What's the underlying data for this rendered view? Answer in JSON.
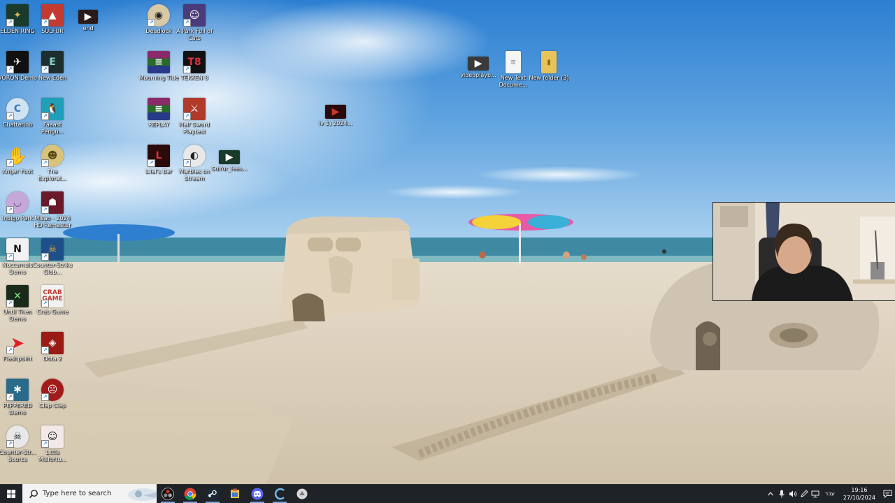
{
  "desktop": {
    "icons": [
      {
        "label": "ELDEN RING",
        "icon": "elden-ring-icon",
        "color": "#1a3a2c"
      },
      {
        "label": "SULFUR",
        "icon": "sulfur-icon",
        "color": "#c23a30"
      },
      {
        "label": "end",
        "icon": "video-file-icon",
        "color": "#2a1a1a"
      },
      {
        "label": "Deadlock",
        "icon": "deadlock-icon",
        "color": "#d7c9a4"
      },
      {
        "label": "A Park Full of Cats",
        "icon": "park-full-of-cats-icon",
        "color": "#4a3b7a"
      },
      {
        "label": "VORON Demo",
        "icon": "voron-icon",
        "color": "#111111"
      },
      {
        "label": "New Eden",
        "icon": "new-eden-icon",
        "color": "#1f2e2e"
      },
      {
        "label": "Mourning Tide",
        "icon": "winrar-icon",
        "color": "#8a2a6a"
      },
      {
        "label": "TEKKEN 8",
        "icon": "tekken-icon",
        "color": "#111111"
      },
      {
        "label": "Chatterino",
        "icon": "chatterino-icon",
        "color": "#cfe3f2"
      },
      {
        "label": "Faaast Pengu...",
        "icon": "penguin-icon",
        "color": "#1f9fb8"
      },
      {
        "label": "REPLAY",
        "icon": "winrar-icon",
        "color": "#8a2a6a"
      },
      {
        "label": "Half Sword Playtest",
        "icon": "half-sword-icon",
        "color": "#b23a2a"
      },
      {
        "label": "Anger Foot",
        "icon": "anger-foot-icon",
        "color": "#e0307a"
      },
      {
        "label": "The Explorat...",
        "icon": "explorer-icon",
        "color": "#d8c37a"
      },
      {
        "label": "Lilal's Bar",
        "icon": "lilals-bar-icon",
        "color": "#2a0a0a"
      },
      {
        "label": "Marbles on Stream",
        "icon": "marbles-icon",
        "color": "#e8e8e8"
      },
      {
        "label": "Sulfur_leas...",
        "icon": "video-file-icon",
        "color": "#1a3a2a"
      },
      {
        "label": "Indigo Park",
        "icon": "indigo-park-icon",
        "color": "#c5a8d8"
      },
      {
        "label": "Misao - 2024 HD Remaster",
        "icon": "misao-icon",
        "color": "#6a1a2a"
      },
      {
        "label": "Nocturnals Demo",
        "icon": "nocturnals-icon",
        "color": "#f2f2f2"
      },
      {
        "label": "Counter-Strike Glob...",
        "icon": "csgo-icon",
        "color": "#1d4f8a"
      },
      {
        "label": "Until Then Demo",
        "icon": "until-then-icon",
        "color": "#1a2a1a"
      },
      {
        "label": "Crab Game",
        "icon": "crab-game-icon",
        "color": "#f2f2f2"
      },
      {
        "label": "Flashpoint",
        "icon": "flashpoint-icon",
        "color": "#e01e2a"
      },
      {
        "label": "Dota 2",
        "icon": "dota2-icon",
        "color": "#9a1a14"
      },
      {
        "label": "PEPPERED Demo",
        "icon": "peppered-icon",
        "color": "#2a6a8a"
      },
      {
        "label": "Clap Clap",
        "icon": "clap-clap-icon",
        "color": "#a31a1a"
      },
      {
        "label": "Counter-Str... Source",
        "icon": "css-icon",
        "color": "#e8e8e8"
      },
      {
        "label": "Little Misfortu...",
        "icon": "little-misfortune-icon",
        "color": "#f2e8e8"
      },
      {
        "label": "lv 1) 2024...",
        "icon": "video-file-icon",
        "color": "#2a0a0a"
      },
      {
        "label": "videoplayb...",
        "icon": "video-file-icon",
        "color": "#3a3a3a"
      },
      {
        "label": "New Text Docume...",
        "icon": "text-document-icon",
        "color": "#f5f5f5"
      },
      {
        "label": "New folder (3)",
        "icon": "folder-icon",
        "color": "#e8c35a"
      }
    ]
  },
  "taskbar": {
    "search_placeholder": "Type here to search",
    "apps": [
      {
        "name": "obs-icon",
        "active": true
      },
      {
        "name": "chrome-icon",
        "active": true
      },
      {
        "name": "steam-icon",
        "active": true
      },
      {
        "name": "file-explorer-icon",
        "active": false
      },
      {
        "name": "discord-icon",
        "active": true
      },
      {
        "name": "chatterino-icon",
        "active": true
      },
      {
        "name": "misc-app-icon",
        "active": false
      }
    ],
    "tray": {
      "language": "עבר",
      "time": "19:16",
      "date": "27/10/2024"
    }
  }
}
